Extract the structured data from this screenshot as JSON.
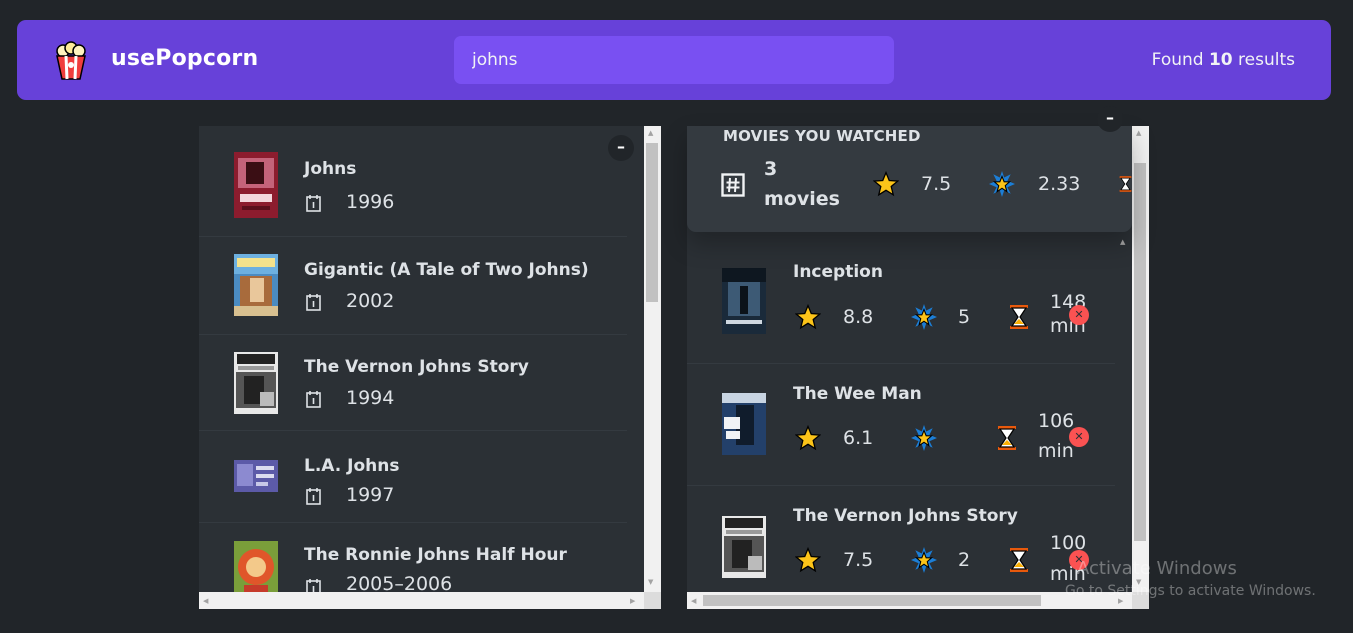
{
  "app": {
    "name": "usePopcorn"
  },
  "search": {
    "value": "johns",
    "results_prefix": "Found ",
    "results_count": "10",
    "results_suffix": " results"
  },
  "search_results": [
    {
      "title": "Johns",
      "year": "1996"
    },
    {
      "title": "Gigantic (A Tale of Two Johns)",
      "year": "2002"
    },
    {
      "title": "The Vernon Johns Story",
      "year": "1994"
    },
    {
      "title": "L.A. Johns",
      "year": "1997"
    },
    {
      "title": "The Ronnie Johns Half Hour",
      "year": "2005–2006"
    }
  ],
  "summary": {
    "heading": "MOVIES YOU WATCHED",
    "count_number": "3",
    "count_label": "movies",
    "avg_imdb": "7.5",
    "avg_user": "2.33"
  },
  "watched": [
    {
      "title": "Inception",
      "imdb": "8.8",
      "user": "5",
      "runtime": "148",
      "unit": "min"
    },
    {
      "title": "The Wee Man",
      "imdb": "6.1",
      "user": "",
      "runtime": "106",
      "unit": "min"
    },
    {
      "title": "The Vernon Johns Story",
      "imdb": "7.5",
      "user": "2",
      "runtime": "100",
      "unit": "min"
    }
  ],
  "toggles": {
    "left": "–",
    "right": "–"
  },
  "watermark": {
    "line1": "Activate Windows",
    "line2": "Go to Settings to activate Windows."
  },
  "colors": {
    "background": "#212529",
    "nav": "#6741d9",
    "search": "#7950f2",
    "box": "#2b3035",
    "summary": "#343a40",
    "delete": "#fa5252"
  }
}
